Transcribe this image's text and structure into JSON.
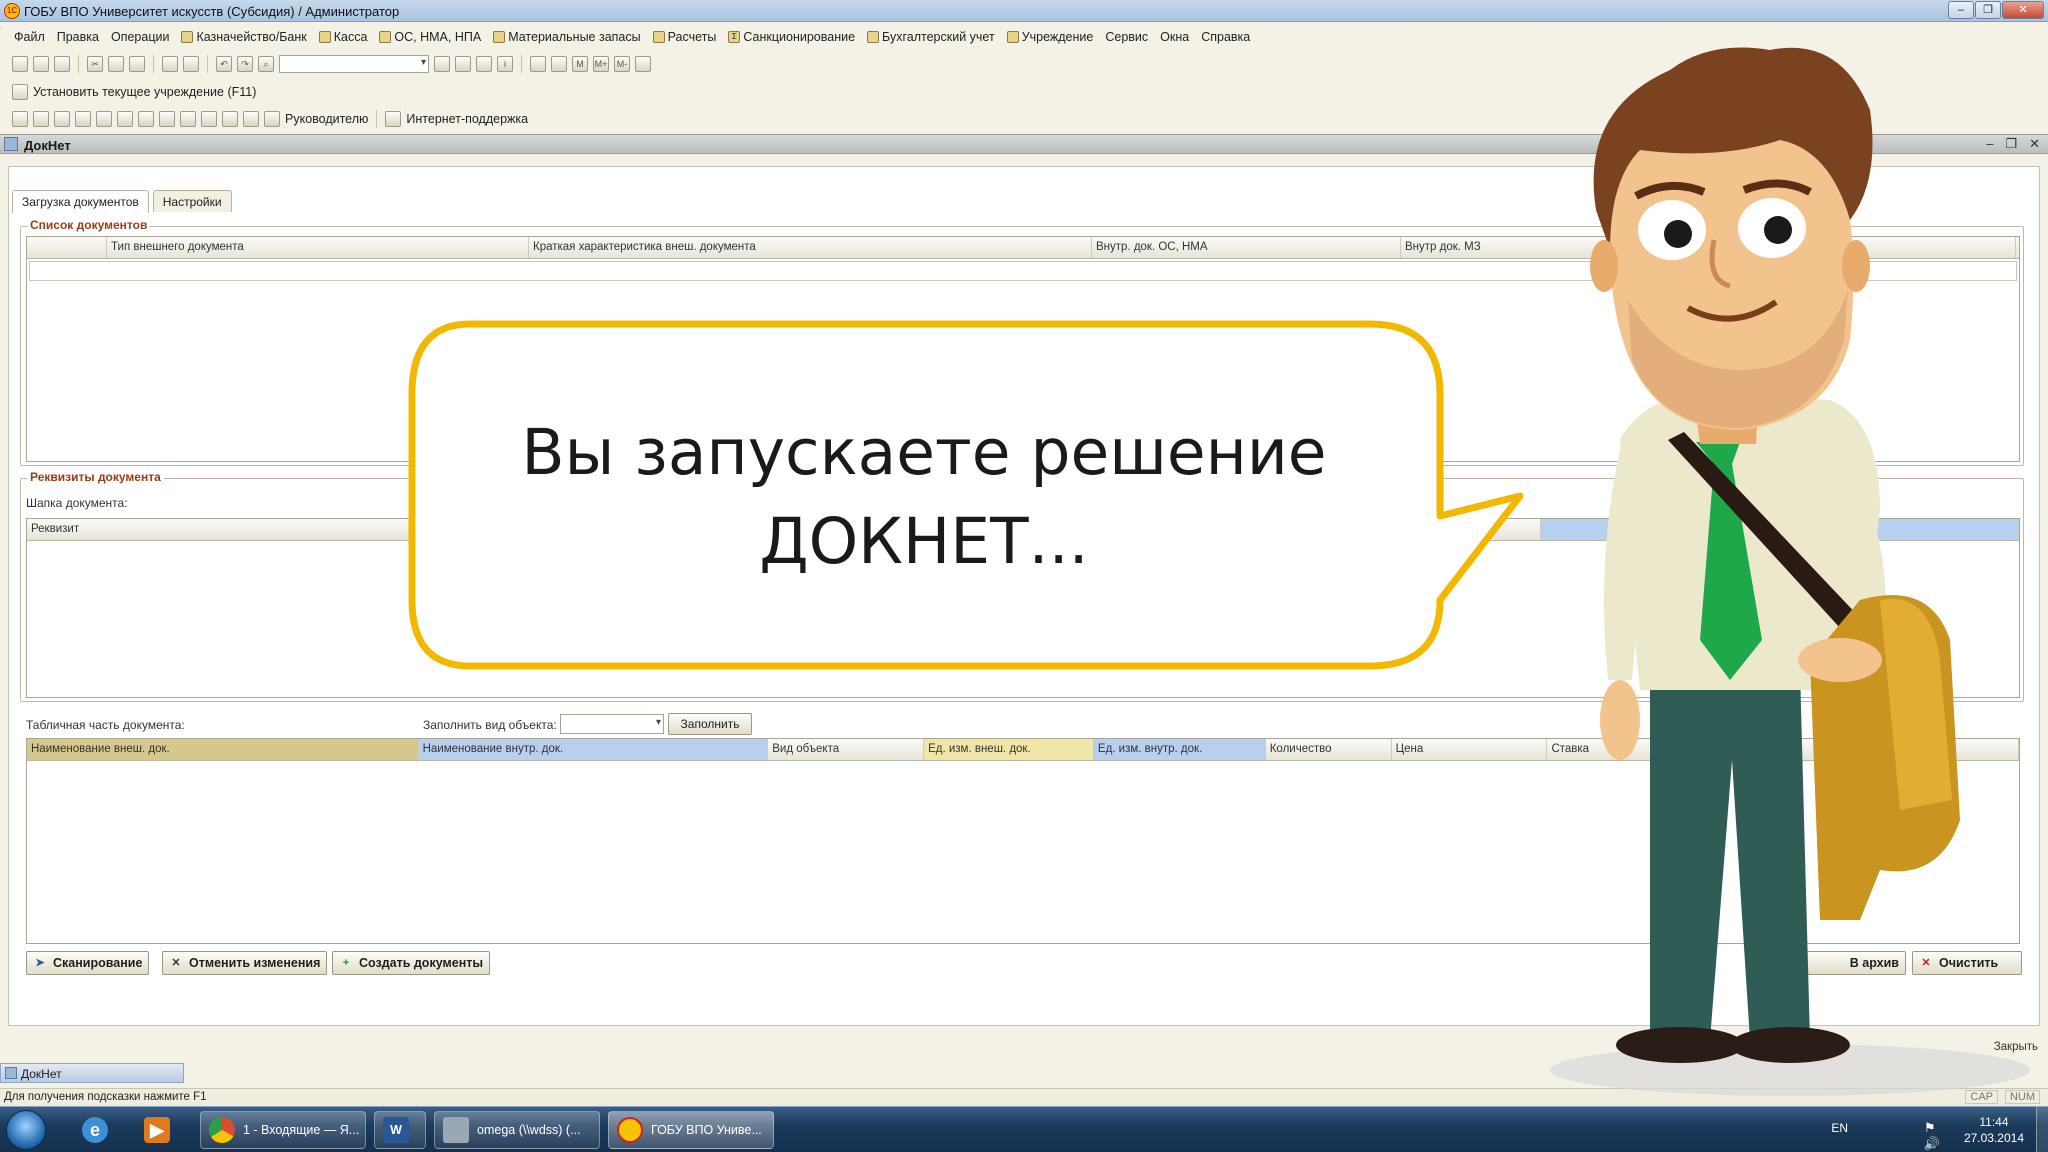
{
  "window": {
    "title": "ГОБУ ВПО Университет искусств (Субсидия) / Администратор",
    "app_icon": "1c-logo-icon"
  },
  "menu": [
    {
      "label": "Файл",
      "icon": ""
    },
    {
      "label": "Правка",
      "icon": ""
    },
    {
      "label": "Операции",
      "icon": ""
    },
    {
      "label": "Казначейство/Банк",
      "icon": "bank-icon"
    },
    {
      "label": "Касса",
      "icon": "cash-icon"
    },
    {
      "label": "ОС, НМА, НПА",
      "icon": "truck-icon"
    },
    {
      "label": "Материальные запасы",
      "icon": "box-icon"
    },
    {
      "label": "Расчеты",
      "icon": "calc-icon"
    },
    {
      "label": "Санкционирование",
      "icon": "sum-icon"
    },
    {
      "label": "Бухгалтерский учет",
      "icon": "abacus-icon"
    },
    {
      "label": "Учреждение",
      "icon": "building-icon"
    },
    {
      "label": "Сервис",
      "icon": ""
    },
    {
      "label": "Окна",
      "icon": ""
    },
    {
      "label": "Справка",
      "icon": ""
    }
  ],
  "toolbar3": {
    "set_org": "Установить текущее учреждение (F11)"
  },
  "toolbar4": {
    "manager": "Руководителю",
    "support": "Интернет-поддержка"
  },
  "doc_window": {
    "title": "ДокНет"
  },
  "tabs": [
    {
      "label": "Загрузка документов",
      "active": true
    },
    {
      "label": "Настройки",
      "active": false
    }
  ],
  "doc_list": {
    "title": "Список документов",
    "columns": [
      "",
      "Тип внешнего документа",
      "Краткая характеристика внеш. документа",
      "Внутр. док. ОС, НМА",
      "Внутр док. МЗ"
    ]
  },
  "requisites": {
    "title": "Реквизиты документа",
    "header_label": "Шапка документа:",
    "columns": [
      "Реквизит"
    ]
  },
  "table_part": {
    "label": "Табличная часть документа:",
    "fill_label": "Заполнить вид объекта:",
    "fill_value": "",
    "fill_button": "Заполнить",
    "columns": [
      {
        "label": "Наименование внеш. док.",
        "color": "#d4c88a"
      },
      {
        "label": "Наименование внутр. док.",
        "color": "#b9cfee"
      },
      {
        "label": "Вид объекта",
        "color": ""
      },
      {
        "label": "Ед. изм. внеш. док.",
        "color": "#efe6a8"
      },
      {
        "label": "Ед. изм. внутр. док.",
        "color": "#b9cfee"
      },
      {
        "label": "Количество",
        "color": ""
      },
      {
        "label": "Цена",
        "color": ""
      },
      {
        "label": "Ставка",
        "color": ""
      }
    ]
  },
  "buttons": {
    "scan": "Сканирование",
    "cancel": "Отменить изменения",
    "create": "Создать документы",
    "archive": "В архив",
    "clear": "Очистить"
  },
  "close_link": "Закрыть",
  "bottom_tab": "ДокНет",
  "status": {
    "hint": "Для получения подсказки нажмите F1",
    "cap": "CAP",
    "num": "NUM"
  },
  "taskbar": {
    "windows": [
      {
        "label": "1 - Входящие — Я...",
        "icon_color": "#d94b32"
      },
      {
        "label": "",
        "icon_color": "#2b5797"
      },
      {
        "label": "omega (\\\\wdss) (...",
        "icon_color": "#9aa7b5"
      },
      {
        "label": "ГОБУ ВПО Униве...",
        "icon_color": "#f5c400"
      }
    ],
    "lang": "EN",
    "time": "11:44",
    "date": "27.03.2014"
  },
  "overlay": {
    "bubble_line1": "Вы запускаете решение",
    "bubble_line2": "ДОКНЕТ..."
  },
  "colors": {
    "bubble_border": "#f2b800",
    "tie": "#1fa84a",
    "group_title": "#9c3b16"
  }
}
